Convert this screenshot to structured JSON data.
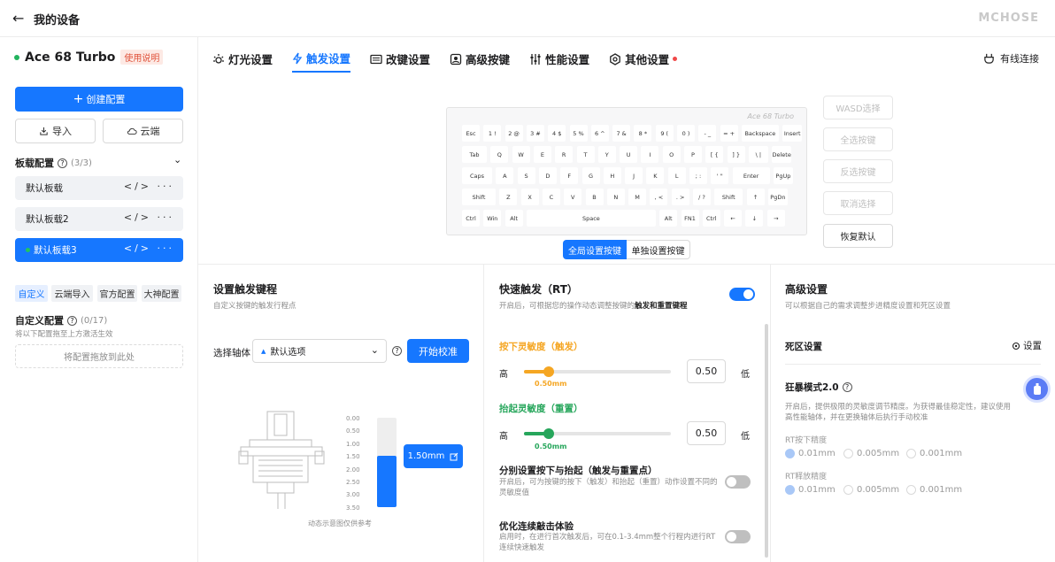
{
  "header": {
    "back_icon": "←",
    "title": "我的设备",
    "brand": "MCHOSE"
  },
  "device": {
    "name": "Ace 68 Turbo",
    "manual_label": "使用说明"
  },
  "sidebar": {
    "create_label": "创建配置",
    "import_label": "导入",
    "cloud_label": "云端",
    "board_section": "板载配置",
    "board_count": "(3/3)",
    "boards": [
      {
        "label": "默认板载"
      },
      {
        "label": "默认板载2"
      },
      {
        "label": "默认板载3"
      }
    ],
    "chips": [
      {
        "label": "自定义"
      },
      {
        "label": "云端导入"
      },
      {
        "label": "官方配置"
      },
      {
        "label": "大神配置"
      }
    ],
    "custom_section": "自定义配置",
    "custom_count": "(0/17)",
    "custom_hint": "将以下配置拖至上方激活生效",
    "drop_label": "将配置拖放到此处"
  },
  "tabs": [
    {
      "label": "灯光设置",
      "icon": "light-icon"
    },
    {
      "label": "触发设置",
      "icon": "bolt-icon"
    },
    {
      "label": "改键设置",
      "icon": "keyboard-icon"
    },
    {
      "label": "高级按键",
      "icon": "advanced-key-icon"
    },
    {
      "label": "性能设置",
      "icon": "sliders-icon"
    },
    {
      "label": "其他设置",
      "icon": "hex-gear-icon"
    }
  ],
  "connection": {
    "label": "有线连接"
  },
  "keyboard": {
    "brand": "Ace 68 Turbo",
    "rows": [
      [
        "Esc",
        "1 !",
        "2 @",
        "3 #",
        "4 $",
        "5 %",
        "6 ^",
        "7 &",
        "8 *",
        "9 (",
        "0 )",
        "- _",
        "= +",
        "Backspace",
        "Insert"
      ],
      [
        "Tab",
        "Q",
        "W",
        "E",
        "R",
        "T",
        "Y",
        "U",
        "I",
        "O",
        "P",
        "[ {",
        "] }",
        "\\ |",
        "Delete"
      ],
      [
        "Caps",
        "A",
        "S",
        "D",
        "F",
        "G",
        "H",
        "J",
        "K",
        "L",
        "; :",
        "' \"",
        "Enter",
        "PgUp"
      ],
      [
        "Shift",
        "Z",
        "X",
        "C",
        "V",
        "B",
        "N",
        "M",
        ", <",
        ". >",
        "/ ?",
        "Shift",
        "↑",
        "PgDn"
      ],
      [
        "Ctrl",
        "Win",
        "Alt",
        "Space",
        "Alt",
        "FN1",
        "Ctrl",
        "←",
        "↓",
        "→"
      ]
    ]
  },
  "key_actions": {
    "wasd": "WASD选择",
    "select_all": "全选按键",
    "invert": "反选按键",
    "cancel": "取消选择",
    "restore": "恢复默认"
  },
  "mode_switch": {
    "global": "全局设置按键",
    "single": "单独设置按键"
  },
  "trigger": {
    "title": "设置触发键程",
    "subtitle": "自定义按键的触发行程点",
    "switch_label": "选择轴体",
    "switch_value": "默认选项",
    "calibrate": "开始校准",
    "scale": [
      "0.00",
      "0.50",
      "1.00",
      "1.50",
      "2.00",
      "2.50",
      "3.00",
      "3.50"
    ],
    "travel_value": "1.50mm",
    "travel_fraction": 0.43,
    "note": "动态示意图仅供参考"
  },
  "rt": {
    "title": "快速触发（RT）",
    "subtitle_a": "开启后，可根据您的操作动态调整按键的",
    "subtitle_b": "触发和重置键程",
    "enabled": true,
    "press_title": "按下灵敏度（触发）",
    "press_high": "高",
    "press_low": "低",
    "press_value": "0.50",
    "press_label": "0.50mm",
    "press_fraction": 0.17,
    "lift_title": "抬起灵敏度（重置）",
    "lift_high": "高",
    "lift_low": "低",
    "lift_value": "0.50",
    "lift_label": "0.50mm",
    "lift_fraction": 0.17,
    "sep_title": "分别设置按下与抬起（触发与重置点）",
    "sep_desc": "开启后，可为按键的按下（触发）和抬起（重置）动作设置不同的灵敏度值",
    "opt_title": "优化连续敲击体验",
    "opt_desc": "启用时，在进行首次触发后，可在0.1-3.4mm整个行程内进行RT连续快速触发",
    "color_press": "#f5a623",
    "color_lift": "#26a65b"
  },
  "advanced": {
    "title": "高级设置",
    "subtitle": "可以根据自己的需求调整步进精度设置和死区设置",
    "deadzone_label": "死区设置",
    "deadzone_btn": "设置",
    "frenzy_title": "狂暴模式2.0",
    "frenzy_desc": "开启后，提供极限的灵敏度调节精度。为获得最佳稳定性，建议使用高性能轴体，并在更换轴体后执行手动校准",
    "rt_press_label": "RT按下精度",
    "rt_lift_label": "RT释放精度",
    "options": [
      "0.01mm",
      "0.005mm",
      "0.001mm"
    ]
  },
  "colors": {
    "accent": "#1677ff"
  }
}
